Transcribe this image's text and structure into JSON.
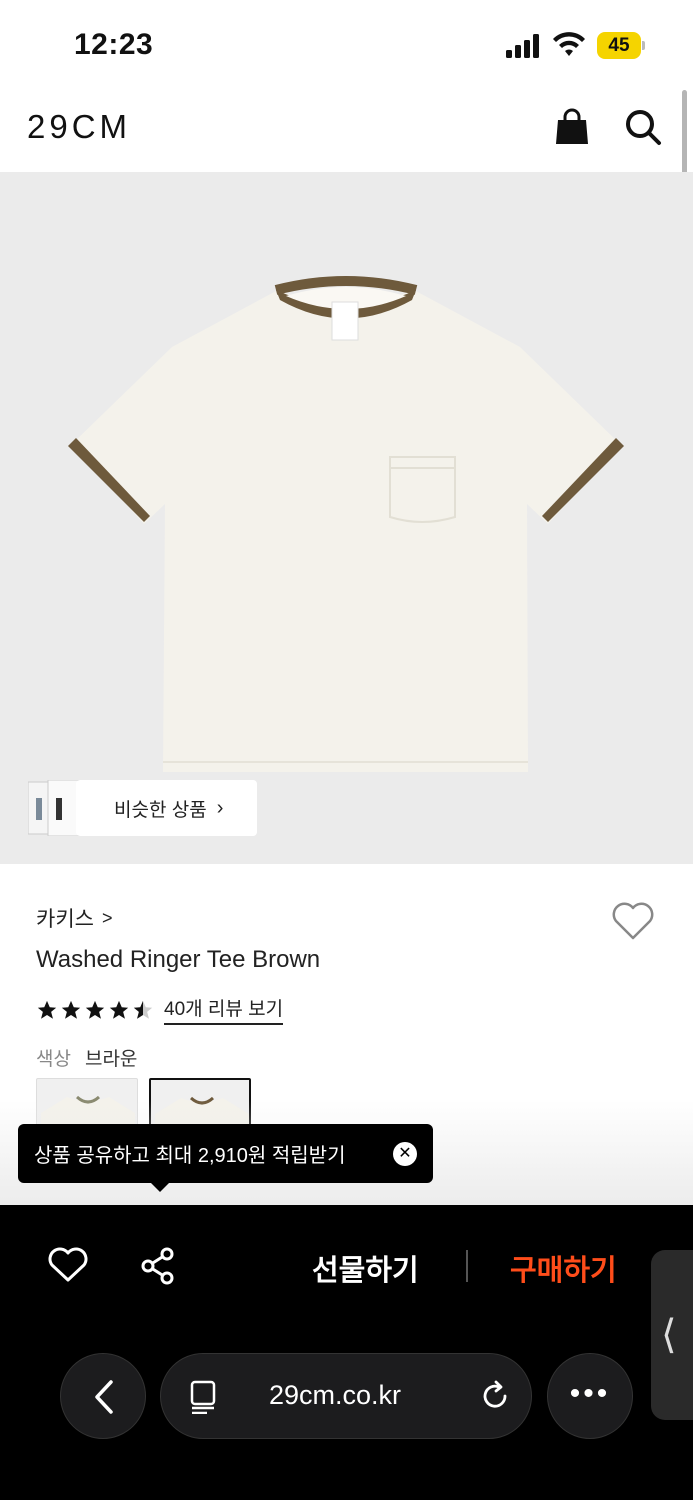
{
  "status_bar": {
    "time": "12:23",
    "battery": "45"
  },
  "header": {
    "logo": "29CM",
    "bag_icon": "shopping-bag-icon",
    "search_icon": "search-icon"
  },
  "hero": {
    "similar_label": "비슷한 상품",
    "similar_chevron": "›"
  },
  "product": {
    "brand": "카키스",
    "brand_chevron": ">",
    "title": "Washed Ringer Tee Brown",
    "rating": 4.5,
    "review_link": "40개 리뷰 보기",
    "color_label": "색상",
    "color_value": "브라운"
  },
  "colors": {
    "shirt": "#f3f1ea",
    "trim": "#6e5a3c",
    "background": "#ebebeb",
    "buy": "#ff4d1a"
  },
  "tooltip": {
    "text": "상품 공유하고 최대 2,910원 적립받기",
    "close": "✕"
  },
  "action_bar": {
    "gift_label": "선물하기",
    "buy_label": "구매하기",
    "side_tab": "⟨"
  },
  "browser": {
    "url": "29cm.co.kr",
    "back": "‹",
    "more": "•••"
  }
}
